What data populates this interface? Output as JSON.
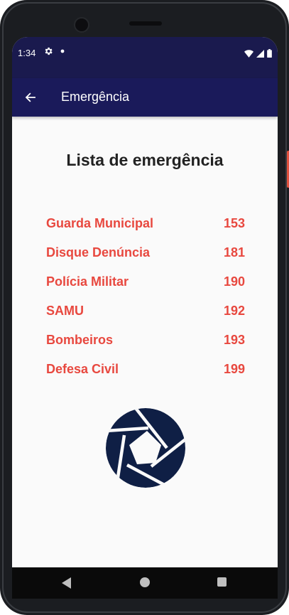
{
  "status_bar": {
    "time": "1:34",
    "settings_icon": "gear-icon",
    "notification_icon": "dot-icon",
    "wifi_icon": "wifi-icon",
    "signal_icon": "signal-icon",
    "battery_icon": "battery-icon"
  },
  "app_bar": {
    "back_icon": "arrow-left-icon",
    "title": "Emergência"
  },
  "main": {
    "heading": "Lista de emergência",
    "contacts": [
      {
        "name": "Guarda Municipal",
        "number": "153"
      },
      {
        "name": "Disque Denúncia",
        "number": "181"
      },
      {
        "name": "Polícia Militar",
        "number": "190"
      },
      {
        "name": "SAMU",
        "number": "192"
      },
      {
        "name": "Bombeiros",
        "number": "193"
      },
      {
        "name": "Defesa Civil",
        "number": "199"
      }
    ],
    "logo_icon": "camera-shutter-icon"
  },
  "navigation_bar": {
    "back": "nav-back-icon",
    "home": "nav-home-icon",
    "recents": "nav-recents-icon"
  },
  "colors": {
    "status_bar": "#1a1a4e",
    "app_bar": "#1a1a5a",
    "accent_red": "#e8483f",
    "logo_navy": "#0f1f45",
    "background": "#fafafa"
  }
}
